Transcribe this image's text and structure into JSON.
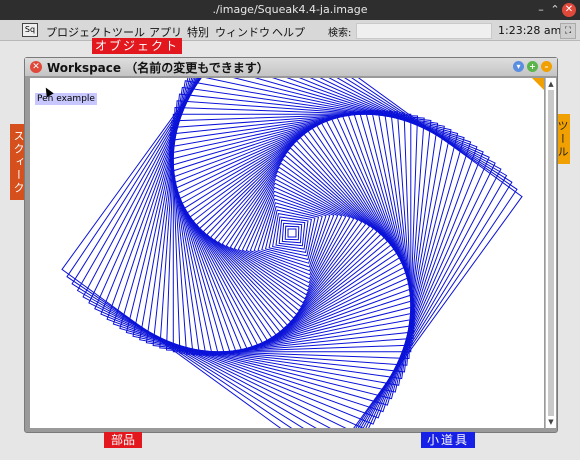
{
  "os_window": {
    "title": "./image/Squeak4.4-ja.image",
    "minimize": "–",
    "maximize": "⌃",
    "close": "✕"
  },
  "menubar": {
    "logo": "Sq",
    "items": [
      "プロジェクト",
      "ツール",
      "アプリ",
      "特別",
      "ウィンドウ",
      "ヘルプ"
    ],
    "search_label": "検索:",
    "search_value": "",
    "clock": "1:23:28 am"
  },
  "flaps": {
    "top": "オブジェクト",
    "left": "スクィーク",
    "right": "ツール",
    "bottom_left": "部品",
    "bottom_right": "小道具"
  },
  "workspace": {
    "title": "Workspace （名前の変更もできます）",
    "pen_label": "Pen example"
  },
  "colors": {
    "pen": "#0b12d8",
    "flap_red": "#e2181e",
    "flap_orange": "#d6501e",
    "flap_yellow": "#f0a000",
    "flap_blue": "#1720e6"
  },
  "icons": {
    "close": "close-icon",
    "collapse": "collapse-icon",
    "expand": "expand-icon",
    "menu": "menu-icon"
  }
}
